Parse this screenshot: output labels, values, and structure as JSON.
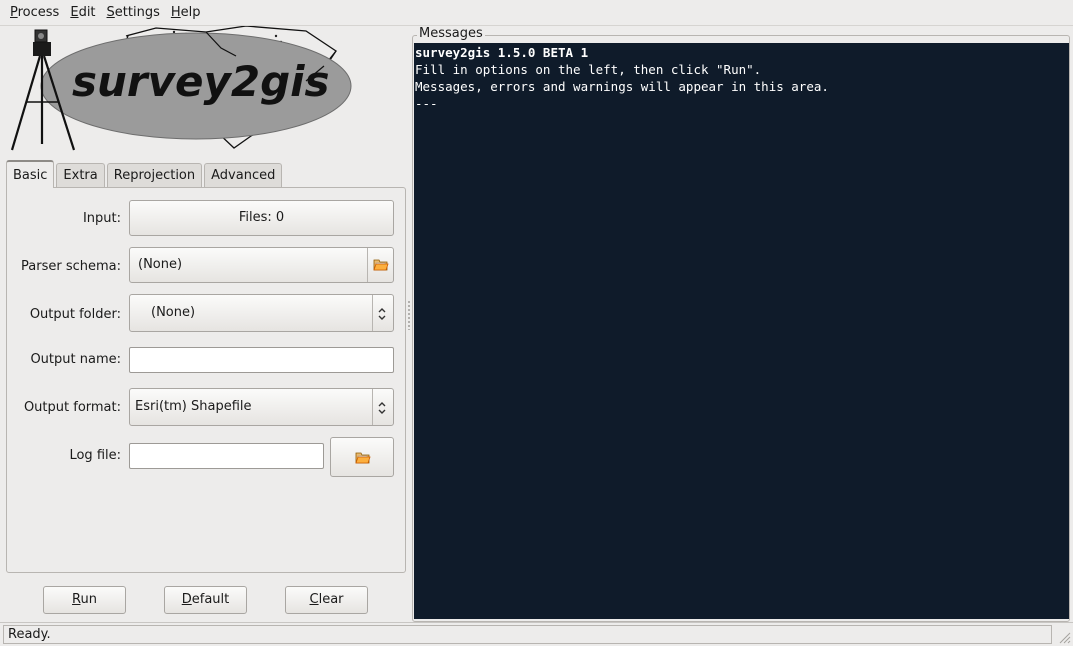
{
  "menu": [
    {
      "mnemonic": "P",
      "rest": "rocess"
    },
    {
      "mnemonic": "E",
      "rest": "dit"
    },
    {
      "mnemonic": "S",
      "rest": "ettings"
    },
    {
      "mnemonic": "H",
      "rest": "elp"
    }
  ],
  "logo": {
    "text": "survey2gis"
  },
  "tabs": [
    "Basic",
    "Extra",
    "Reprojection",
    "Advanced"
  ],
  "form": {
    "input_label": "Input:",
    "input_button": "Files: 0",
    "parser_label": "Parser schema:",
    "parser_value": "(None)",
    "output_folder_label": "Output folder:",
    "output_folder_value": "(None)",
    "output_name_label": "Output name:",
    "output_name_value": "",
    "output_format_label": "Output format:",
    "output_format_value": "Esri(tm) Shapefile",
    "log_file_label": "Log file:",
    "log_file_value": ""
  },
  "buttons": {
    "run": {
      "mnemonic": "R",
      "rest": "un"
    },
    "default": {
      "mnemonic": "D",
      "rest": "efault"
    },
    "clear": {
      "mnemonic": "C",
      "rest": "lear"
    }
  },
  "messages": {
    "title": "Messages",
    "lines": [
      "survey2gis 1.5.0 BETA 1",
      "Fill in options on the left, then click \"Run\".",
      "Messages, errors and warnings will appear in this area.",
      "---"
    ],
    "background": "#0f1b2a"
  },
  "status": {
    "text": "Ready."
  },
  "icons": {
    "folder": "folder-open-icon",
    "spinner": "up-down-arrows-icon"
  }
}
